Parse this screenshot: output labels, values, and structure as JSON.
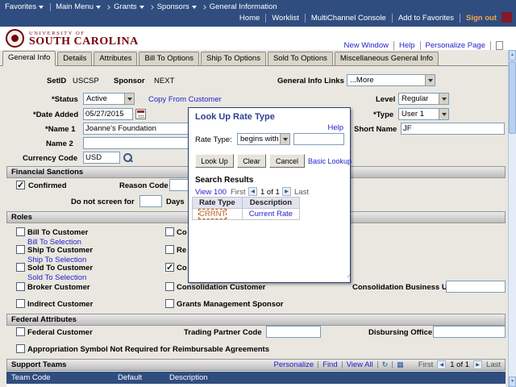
{
  "colors": {
    "topbar_blue": "#2F4D7F",
    "garnet": "#73000A",
    "link_blue": "#2222CC",
    "signout_orange": "#F0A54C",
    "lookup_result_orange": "#C05A10"
  },
  "icons": {
    "prev": "◀",
    "next": "▶",
    "up": "▲",
    "down": "▼",
    "refresh": "↻",
    "grid": "▦",
    "grip": "..."
  },
  "topbar": {
    "favorites": "Favorites",
    "breadcrumbs": [
      "Main Menu",
      "Grants",
      "Sponsors",
      "General Information"
    ],
    "links": [
      "Home",
      "Worklist",
      "MultiChannel Console",
      "Add to Favorites"
    ],
    "signout": "Sign out"
  },
  "banner": {
    "line1": "UNIVERSITY OF",
    "line2": "SOUTH CAROLINA"
  },
  "pagebar": {
    "links": [
      "New Window",
      "Help",
      "Personalize Page"
    ]
  },
  "tabs": [
    {
      "label": "General Info",
      "active": true
    },
    {
      "label": "Details",
      "active": false
    },
    {
      "label": "Attributes",
      "active": false
    },
    {
      "label": "Bill To Options",
      "active": false
    },
    {
      "label": "Ship To Options",
      "active": false
    },
    {
      "label": "Sold To Options",
      "active": false
    },
    {
      "label": "Miscellaneous General Info",
      "active": false
    }
  ],
  "form": {
    "setid_label": "SetID",
    "setid_value": "USCSP",
    "sponsor_label": "Sponsor",
    "sponsor_value": "NEXT",
    "general_info_links_label": "General Info Links",
    "general_info_links_value": "...More",
    "status_label": "*Status",
    "status_value": "Active",
    "copy_from_customer_link": "Copy From Customer",
    "level_label": "Level",
    "level_value": "Regular",
    "date_added_label": "*Date Added",
    "date_added_value": "05/27/2015",
    "type_label": "*Type",
    "type_value": "User 1",
    "name1_label": "*Name 1",
    "name1_value": "Joanne's Foundation",
    "short_name_label": "Short Name",
    "short_name_value": "JF",
    "name2_label": "Name 2",
    "name2_value": "",
    "currency_code_label": "Currency Code",
    "currency_code_value": "USD"
  },
  "financial_sanctions": {
    "title": "Financial Sanctions",
    "confirmed_label": "Confirmed",
    "confirmed_checked": true,
    "reason_code_label": "Reason Code",
    "reason_code_value": "",
    "do_not_screen_label": "Do not screen for",
    "do_not_screen_value": "",
    "days_label": "Days"
  },
  "roles": {
    "title": "Roles",
    "left_items": [
      {
        "label": "Bill To Customer",
        "link": "Bill To Selection",
        "checked": false
      },
      {
        "label": "Ship To Customer",
        "link": "Ship To Selection",
        "checked": false
      },
      {
        "label": "Sold To Customer",
        "link": "Sold To Selection",
        "checked": false
      },
      {
        "label": "Broker Customer",
        "checked": false
      },
      {
        "label": "Indirect Customer",
        "checked": false
      }
    ],
    "right_items": [
      {
        "label": "Co",
        "checked": false
      },
      {
        "label": "Re",
        "checked": false
      },
      {
        "label": "Co",
        "checked": true
      },
      {
        "label": "Consolidation Customer",
        "checked": false
      },
      {
        "label": "Grants Management Sponsor",
        "checked": false
      }
    ],
    "consolidation_business_unit_label": "Consolidation Business Unit",
    "consolidation_business_unit_value": ""
  },
  "federal": {
    "title": "Federal Attributes",
    "federal_customer_label": "Federal Customer",
    "trading_partner_label": "Trading Partner Code",
    "trading_partner_value": "",
    "disbursing_office_label": "Disbursing Office",
    "disbursing_office_value": "",
    "appropriation_label": "Appropriation Symbol Not Required for Reimbursable Agreements"
  },
  "support_teams": {
    "title": "Support Teams",
    "personalize_link": "Personalize",
    "find_link": "Find",
    "view_all_link": "View All",
    "first_label": "First",
    "page_label": "1 of 1",
    "last_label": "Last",
    "columns": [
      "Team Code",
      "Default",
      "Description"
    ]
  },
  "modal": {
    "title": "Look Up Rate Type",
    "help_link": "Help",
    "rate_type_label": "Rate Type:",
    "operator_value": "begins with",
    "search_value": "",
    "look_up_button": "Look Up",
    "clear_button": "Clear",
    "cancel_button": "Cancel",
    "basic_lookup_link": "Basic Lookup",
    "results_title": "Search Results",
    "view_link": "View 100",
    "first_label": "First",
    "page_label": "1 of 1",
    "last_label": "Last",
    "columns": [
      "Rate Type",
      "Description"
    ],
    "rows": [
      {
        "rate_type": "CRRNT",
        "description": "Current Rate"
      }
    ]
  }
}
